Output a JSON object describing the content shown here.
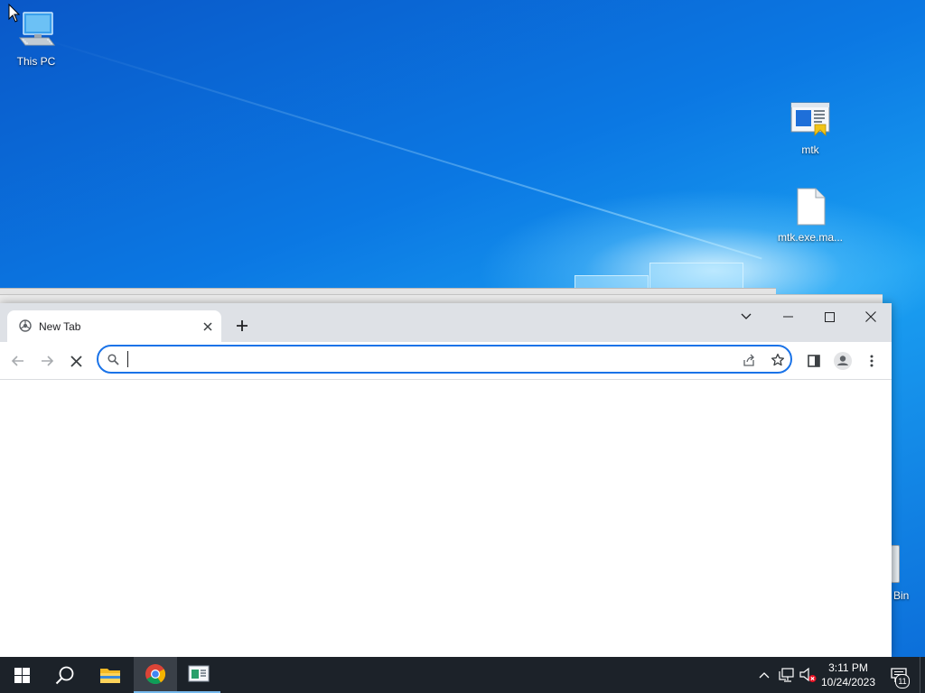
{
  "desktop": {
    "icons": [
      {
        "label": "This PC",
        "icon": "computer-icon"
      },
      {
        "label": "mtk",
        "icon": "mtk-app-icon"
      },
      {
        "label": "mtk.exe.ma...",
        "icon": "file-icon"
      }
    ],
    "recycle_bin_label": "Bin"
  },
  "browser": {
    "tab": {
      "title": "New Tab",
      "icon": "chrome-newtab-icon"
    },
    "omnibox": {
      "value": "",
      "placeholder": ""
    },
    "window_controls": [
      "tab-search",
      "minimize",
      "maximize",
      "close"
    ],
    "accent_color": "#1a73e8"
  },
  "taskbar": {
    "apps": [
      {
        "name": "start",
        "icon": "windows-start-icon"
      },
      {
        "name": "search",
        "icon": "search-icon"
      },
      {
        "name": "file-explorer",
        "icon": "folder-icon"
      },
      {
        "name": "chrome",
        "icon": "chrome-icon",
        "active": true
      },
      {
        "name": "mtk",
        "icon": "mtk-app-icon",
        "running": true
      }
    ],
    "clock": {
      "time": "3:11 PM",
      "date": "10/24/2023"
    },
    "notifications_count": "11"
  }
}
